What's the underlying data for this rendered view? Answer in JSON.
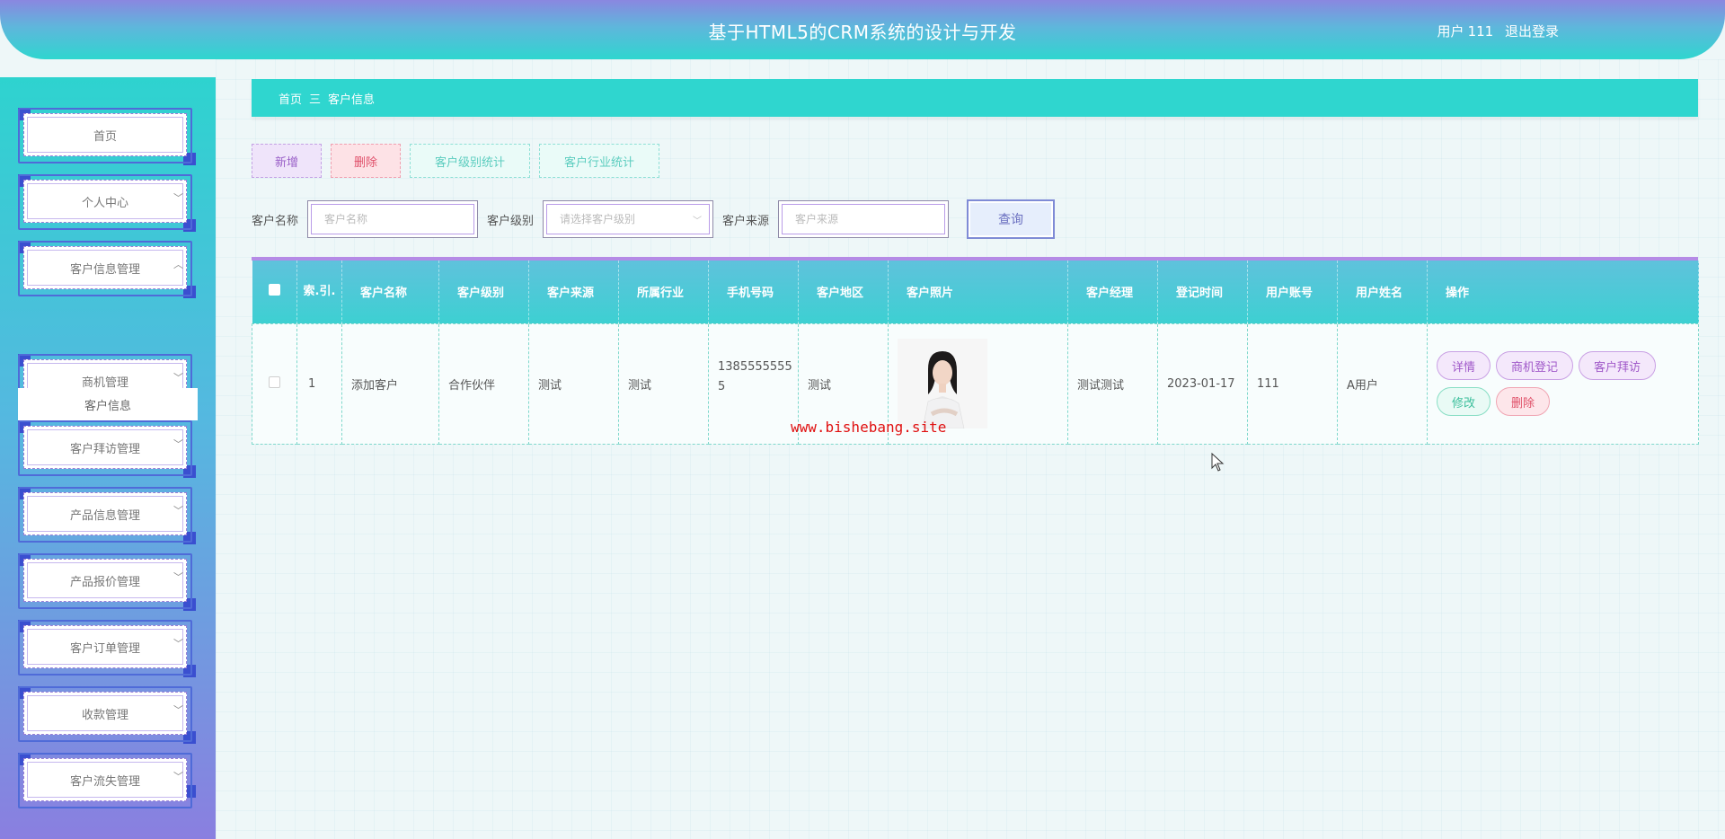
{
  "header": {
    "title": "基于HTML5的CRM系统的设计与开发",
    "user_prefix": "用户",
    "user_name": "111",
    "logout": "退出登录"
  },
  "sidebar": {
    "items": [
      {
        "label": "首页",
        "has_chevron": false
      },
      {
        "label": "个人中心",
        "has_chevron": true,
        "chevron": "﹀"
      },
      {
        "label": "客户信息管理",
        "has_chevron": true,
        "chevron": "︿"
      },
      {
        "label": "商机管理",
        "has_chevron": true,
        "chevron": "﹀"
      },
      {
        "label": "客户拜访管理",
        "has_chevron": true,
        "chevron": "﹀"
      },
      {
        "label": "产品信息管理",
        "has_chevron": true,
        "chevron": "﹀"
      },
      {
        "label": "产品报价管理",
        "has_chevron": true,
        "chevron": "﹀"
      },
      {
        "label": "客户订单管理",
        "has_chevron": true,
        "chevron": "﹀"
      },
      {
        "label": "收款管理",
        "has_chevron": true,
        "chevron": "﹀"
      },
      {
        "label": "客户流失管理",
        "has_chevron": true,
        "chevron": "﹀"
      }
    ],
    "active_submenu": "客户信息"
  },
  "breadcrumb": {
    "home": "首页",
    "separator": "三",
    "current": "客户信息"
  },
  "toolbar": {
    "add": "新增",
    "delete": "删除",
    "level_stats": "客户级别统计",
    "industry_stats": "客户行业统计"
  },
  "search": {
    "name_label": "客户名称",
    "name_placeholder": "客户名称",
    "level_label": "客户级别",
    "level_placeholder": "请选择客户级别",
    "source_label": "客户来源",
    "source_placeholder": "客户来源",
    "query": "查询"
  },
  "table": {
    "headers": [
      "索.引.",
      "客户名称",
      "客户级别",
      "客户来源",
      "所属行业",
      "手机号码",
      "客户地区",
      "客户照片",
      "客户经理",
      "登记时间",
      "用户账号",
      "用户姓名",
      "操作"
    ],
    "rows": [
      {
        "index": "1",
        "name": "添加客户",
        "level": "合作伙伴",
        "source": "测试",
        "industry": "测试",
        "phone": "13855555555",
        "region": "测试",
        "manager": "测试测试",
        "date": "2023-01-17",
        "account": "111",
        "username": "A用户",
        "ops": {
          "detail": "详情",
          "opportunity": "商机登记",
          "visit": "客户拜访",
          "edit": "修改",
          "delete": "删除"
        }
      }
    ]
  },
  "watermark": "www.bishebang.site",
  "colors": {
    "accent": "#2fd6cf",
    "purple": "#8a87e0"
  }
}
